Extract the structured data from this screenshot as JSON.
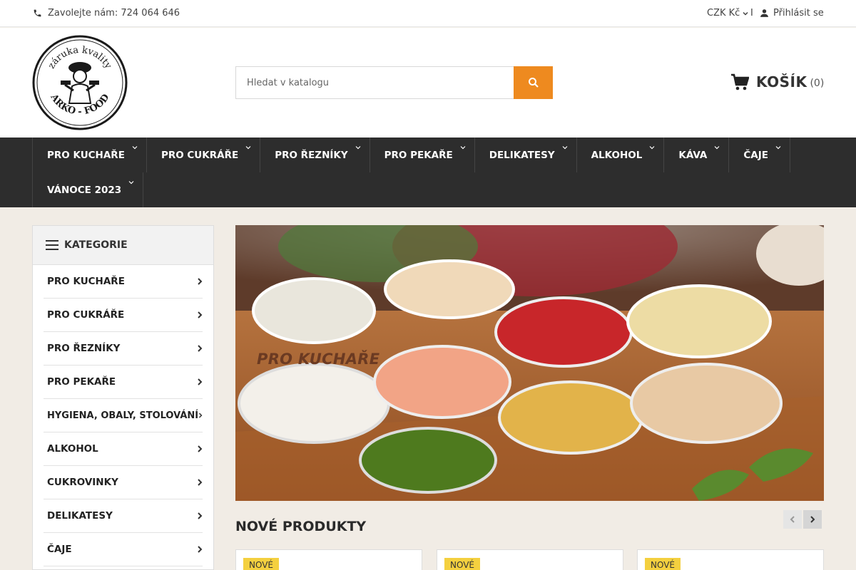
{
  "topbar": {
    "phone_text": "Zavolejte nám: 724 064 646",
    "currency": "CZK Kč",
    "separator": "I",
    "login": "Přihlásit se"
  },
  "header": {
    "logo_alt": "Arko-Food",
    "logo_text_top": "záruka kvality",
    "logo_text_bottom": "ARKO - FOOD",
    "search_placeholder": "Hledat v katalogu",
    "cart_label": "KOŠÍK",
    "cart_count": "(0)"
  },
  "nav": {
    "row1": [
      "PRO KUCHAŘE",
      "PRO CUKRÁŘE",
      "PRO ŘEZNÍKY",
      "PRO PEKAŘE",
      "DELIKATESY",
      "ALKOHOL",
      "KÁVA",
      "ČAJE"
    ],
    "row2": [
      "VÁNOCE 2023"
    ]
  },
  "sidebar": {
    "title": "KATEGORIE",
    "items": [
      "PRO KUCHAŘE",
      "PRO CUKRÁŘE",
      "PRO ŘEZNÍKY",
      "PRO PEKAŘE",
      "HYGIENA, OBALY, STOLOVÁNÍ",
      "ALKOHOL",
      "CUKROVINKY",
      "DELIKATESY",
      "ČAJE"
    ]
  },
  "banner": {
    "caption": "PRO KUCHAŘE"
  },
  "new_products": {
    "title": "NOVÉ PRODUKTY",
    "badges": [
      "NOVÉ",
      "NOVÉ",
      "NOVÉ"
    ]
  },
  "colors": {
    "accent": "#ee8a1f",
    "nav_bg": "#2d2d2d",
    "badge": "#f4d03f"
  }
}
